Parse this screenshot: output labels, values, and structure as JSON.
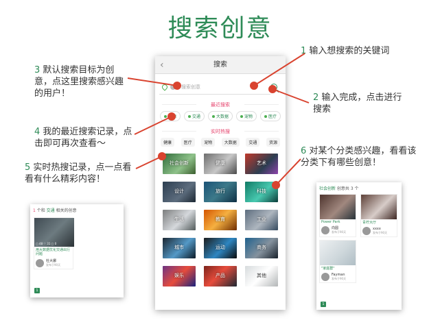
{
  "title": "搜索创意",
  "notes": [
    {
      "num": "1",
      "text": " 输入想搜索的关键词"
    },
    {
      "num": "2",
      "text": " 输入完成，点击进行搜索"
    },
    {
      "num": "3",
      "text": " 默认搜索目标为创意，点这里搜索感兴趣的用户！"
    },
    {
      "num": "4",
      "text": " 我的最近搜索记录，点击即可再次查看～"
    },
    {
      "num": "5",
      "text": " 实时热搜记录，点一点看看有什么精彩内容！"
    },
    {
      "num": "6",
      "text": " 对某个分类感兴趣，看看该分类下有哪些创意！"
    }
  ],
  "phone": {
    "header": "搜索",
    "back_icon": "‹",
    "search_placeholder": "搜索创意",
    "recent_title": "最近搜索",
    "recent_tags": [
      "资源",
      "交通",
      "大数据",
      "宠物",
      "医疗"
    ],
    "hot_title": "实时热搜",
    "hot_tags": [
      "健康",
      "医疗",
      "宠物",
      "大数据",
      "交通",
      "资源"
    ],
    "categories": [
      "社会创新",
      "健康",
      "艺术",
      "设计",
      "旅行",
      "科技",
      "生活",
      "教育",
      "工业",
      "城市",
      "运动",
      "商务",
      "娱乐",
      "产品",
      "其他"
    ]
  },
  "left_card": {
    "count": "1",
    "label_mid": " 个和 ",
    "keyword": "交通",
    "label_end": " 相关的创意",
    "stats": "▢ 48 ♡ 31 ▢ 0",
    "item_title": "用大数据优化交通出行问题",
    "user_name": "杜大娜",
    "user_sub": "发布于90天",
    "page": "1"
  },
  "right_card": {
    "category": "社会创新",
    "count_label": " 创意共 3 个",
    "items": [
      {
        "title": "Power Park",
        "user": "向圆",
        "sub": "发布于90天"
      },
      {
        "title": "青柠大厅",
        "user": "xxxx",
        "sub": "发布于90天"
      },
      {
        "title": "\"家庭群\"",
        "user": "Fayman",
        "sub": "发布于90天"
      }
    ],
    "page": "1"
  },
  "colors": {
    "accent": "#2e8b57",
    "arrow": "#d9432f",
    "pink": "#e6456e"
  }
}
